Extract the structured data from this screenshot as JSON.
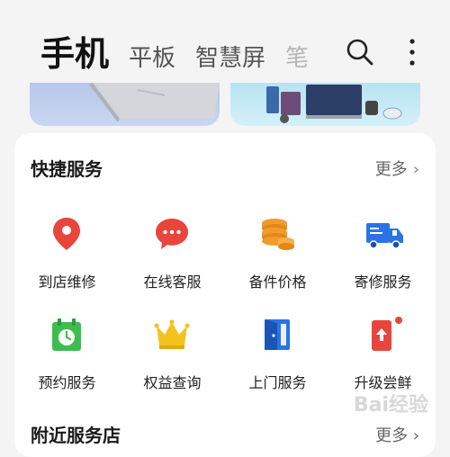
{
  "header": {
    "tabs": [
      {
        "label": "手机",
        "active": true
      },
      {
        "label": "平板",
        "active": false
      },
      {
        "label": "智慧屏",
        "active": false
      },
      {
        "label": "笔",
        "active": false
      }
    ],
    "icons": [
      "search-icon",
      "more-vertical-icon"
    ]
  },
  "quick_services": {
    "title": "快捷服务",
    "more_label": "更多",
    "items": [
      {
        "label": "到店维修",
        "icon": "location-pin-icon",
        "color": "#e8453c"
      },
      {
        "label": "在线客服",
        "icon": "chat-bubble-icon",
        "color": "#e8453c"
      },
      {
        "label": "备件价格",
        "icon": "coins-stack-icon",
        "color": "#f29b2c"
      },
      {
        "label": "寄修服务",
        "icon": "delivery-truck-icon",
        "color": "#2a73e6"
      },
      {
        "label": "预约服务",
        "icon": "calendar-clock-icon",
        "color": "#3ebc4f"
      },
      {
        "label": "权益查询",
        "icon": "crown-icon",
        "color": "#f4c21c"
      },
      {
        "label": "上门服务",
        "icon": "door-icon",
        "color": "#2a73e6"
      },
      {
        "label": "升级尝鲜",
        "icon": "upgrade-phone-icon",
        "color": "#e8453c"
      }
    ]
  },
  "nearby": {
    "title": "附近服务店",
    "more_label": "更多"
  },
  "watermark": "Bai经验"
}
